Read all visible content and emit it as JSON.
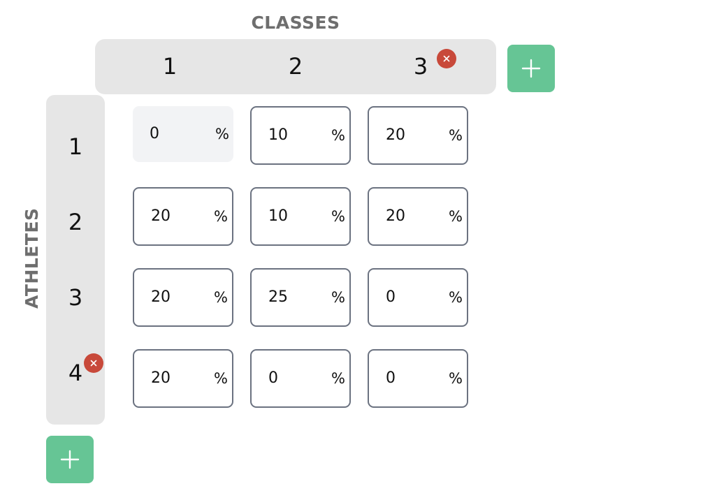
{
  "classes": {
    "title": "CLASSES",
    "headers": [
      "1",
      "2",
      "3"
    ],
    "add_icon": "plus-icon",
    "remove_icon": "close-icon"
  },
  "athletes": {
    "title": "ATHLETES",
    "headers": [
      "1",
      "2",
      "3",
      "4"
    ],
    "add_icon": "plus-icon",
    "remove_icon": "close-icon"
  },
  "grid": {
    "unit": "%",
    "rows": [
      [
        "0",
        "10",
        "20"
      ],
      [
        "20",
        "10",
        "20"
      ],
      [
        "20",
        "25",
        "0"
      ],
      [
        "20",
        "0",
        "0"
      ]
    ]
  },
  "colors": {
    "header_bar": "#e6e6e6",
    "add_button": "#66c595",
    "remove_button": "#c8493a",
    "cell_border": "#6b7280",
    "readonly_cell": "#f2f3f5",
    "axis_title": "#6e6e6e"
  }
}
